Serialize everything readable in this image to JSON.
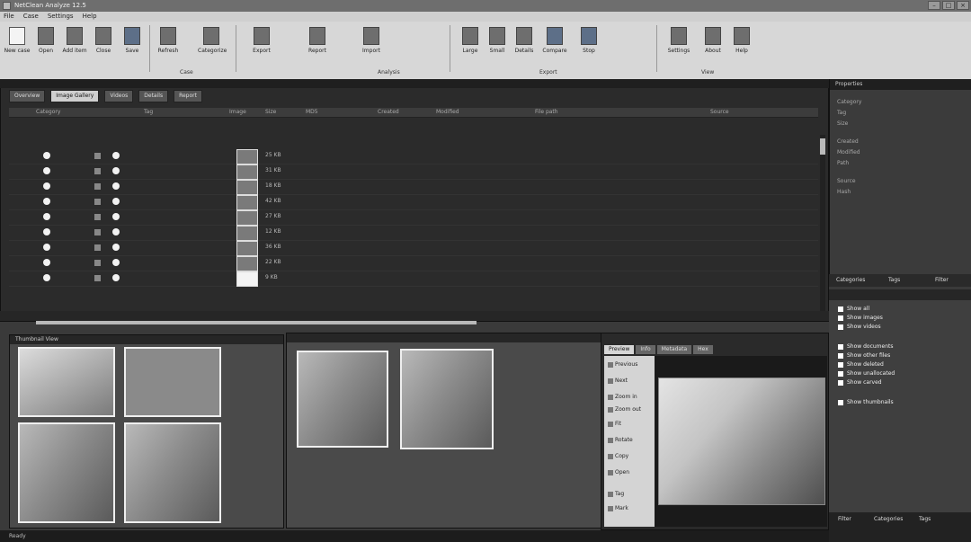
{
  "window": {
    "title": "NetClean Analyze 12.5"
  },
  "menu": [
    "File",
    "Case",
    "Settings",
    "Help"
  ],
  "ribbon": {
    "buttons": [
      "New case",
      "Open",
      "Add item",
      "Close",
      "Save",
      "Refresh",
      "Categorize",
      "Export",
      "Report",
      "Import",
      "Large",
      "Small",
      "Details",
      "Compare",
      "Stop",
      "Settings",
      "About",
      "Help"
    ],
    "groups": [
      "Case",
      "Analysis",
      "Export",
      "View"
    ]
  },
  "main": {
    "tabs": [
      "Overview",
      "Image Gallery",
      "Videos",
      "Details",
      "Report"
    ],
    "columns": [
      "Category",
      "Tag",
      "Image",
      "Size",
      "MD5",
      "Created",
      "Modified",
      "File path",
      "Source"
    ],
    "rows": [
      {
        "size": "25 KB"
      },
      {
        "size": "31 KB"
      },
      {
        "size": "18 KB"
      },
      {
        "size": "42 KB"
      },
      {
        "size": "27 KB"
      },
      {
        "size": "12 KB"
      },
      {
        "size": "36 KB"
      },
      {
        "size": "22 KB"
      },
      {
        "size": "9 KB"
      }
    ]
  },
  "right_panel": {
    "title": "Properties",
    "props": [
      "Category",
      "Tag",
      "Size",
      "Created",
      "Modified",
      "Path",
      "Source",
      "Hash"
    ]
  },
  "right_tabs": [
    "Categories",
    "Tags",
    "Filter"
  ],
  "filters": {
    "options": [
      "Show all",
      "Show images",
      "Show videos",
      "Show documents",
      "Show other files",
      "Show deleted",
      "Show unallocated",
      "Show carved",
      "Show thumbnails"
    ]
  },
  "panes": {
    "thumbnail_title": "Thumbnail View",
    "preview_tabs": [
      "Preview",
      "Info",
      "Metadata",
      "Hex"
    ],
    "side_actions": [
      "Previous",
      "Next",
      "Zoom in",
      "Zoom out",
      "Fit",
      "Rotate",
      "Copy",
      "Open",
      "Tag",
      "Mark"
    ]
  },
  "status": {
    "text": "Ready"
  },
  "colors": {
    "dark_panel": "#2b2b2b",
    "ribbon": "#d7d7d7"
  }
}
